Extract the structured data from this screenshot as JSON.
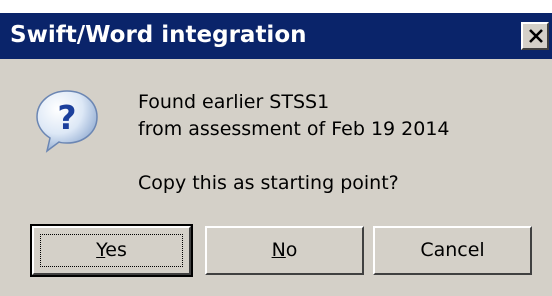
{
  "dialog": {
    "title": "Swift/Word integration",
    "icon": "question-icon",
    "message_line1": "Found earlier STSS1",
    "message_line2": "from assessment of Feb 19 2014",
    "prompt": "Copy this as starting point?",
    "buttons": {
      "yes": {
        "mnemonic": "Y",
        "rest": "es"
      },
      "no": {
        "mnemonic": "N",
        "rest": "o"
      },
      "cancel": {
        "label": "Cancel"
      }
    },
    "default_button": "yes"
  },
  "colors": {
    "title_bar": "#0a246a",
    "dialog_face": "#d4d0c8",
    "title_text": "#ffffff"
  }
}
